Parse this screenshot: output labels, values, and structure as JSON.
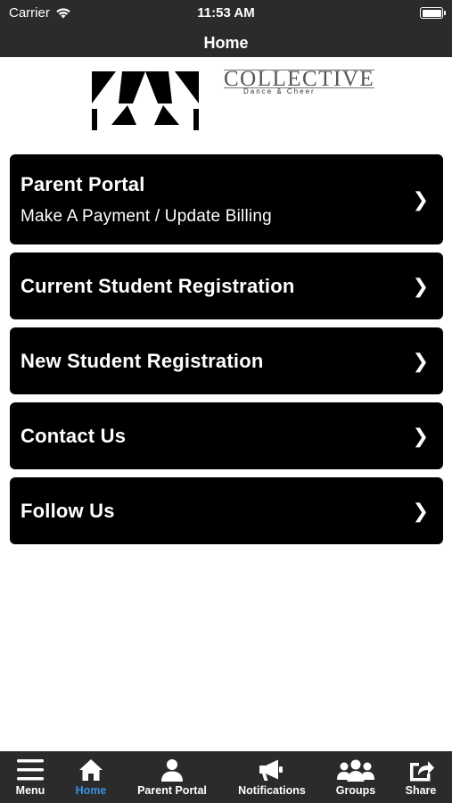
{
  "status_bar": {
    "carrier": "Carrier",
    "time": "11:53 AM"
  },
  "nav": {
    "title": "Home"
  },
  "logo": {
    "wordmark": "COLLECTIVE",
    "tagline": "Dance & Cheer"
  },
  "menu": {
    "items": [
      {
        "title": "Parent Portal",
        "subtitle": "Make A Payment / Update Billing"
      },
      {
        "title": "Current Student Registration"
      },
      {
        "title": "New Student Registration"
      },
      {
        "title": "Contact Us"
      },
      {
        "title": "Follow Us"
      }
    ],
    "chevron": "❯"
  },
  "tabs": [
    {
      "label": "Menu",
      "icon": "hamburger-icon"
    },
    {
      "label": "Home",
      "icon": "home-icon",
      "active": true
    },
    {
      "label": "Parent Portal",
      "icon": "person-icon"
    },
    {
      "label": "Notifications",
      "icon": "megaphone-icon"
    },
    {
      "label": "Groups",
      "icon": "group-icon"
    },
    {
      "label": "Share",
      "icon": "share-icon"
    }
  ],
  "colors": {
    "bar": "#2b2b2b",
    "accent": "#3b8fe0",
    "card": "#000000"
  }
}
